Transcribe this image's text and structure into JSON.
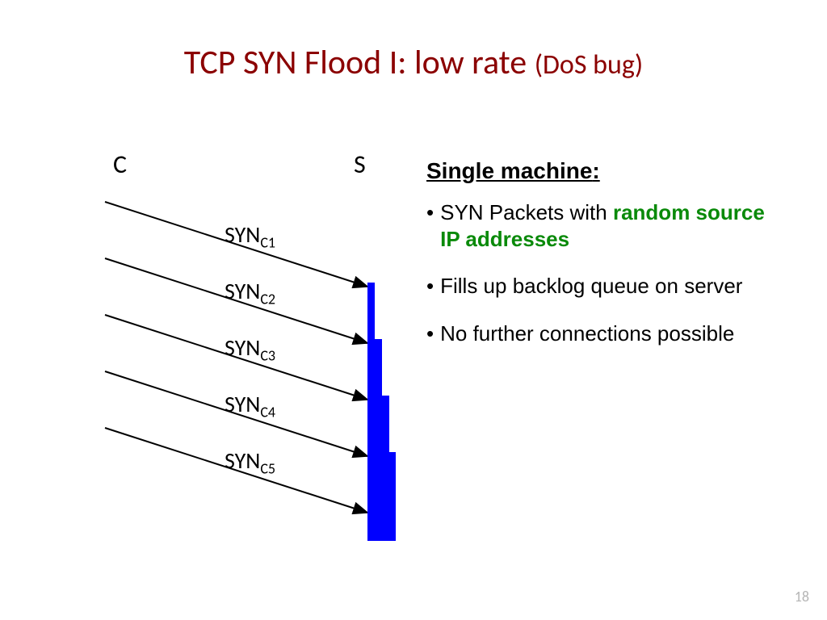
{
  "title": {
    "main": "TCP SYN Flood I:   low rate",
    "sub": "(DoS bug)"
  },
  "labels": {
    "client": "C",
    "server": "S"
  },
  "syn": {
    "s1": {
      "prefix": "SYN",
      "sub": "C1"
    },
    "s2": {
      "prefix": "SYN",
      "sub": "C2"
    },
    "s3": {
      "prefix": "SYN",
      "sub": "C3"
    },
    "s4": {
      "prefix": "SYN",
      "sub": "C4"
    },
    "s5": {
      "prefix": "SYN",
      "sub": "C5"
    }
  },
  "right": {
    "heading": "Single machine",
    "heading_suffix": ":",
    "b1_pre": "SYN Packets with ",
    "b1_green": "random source IP addresses",
    "b2": "Fills up backlog queue on server",
    "b3": "No further connections possible"
  },
  "page": "18"
}
